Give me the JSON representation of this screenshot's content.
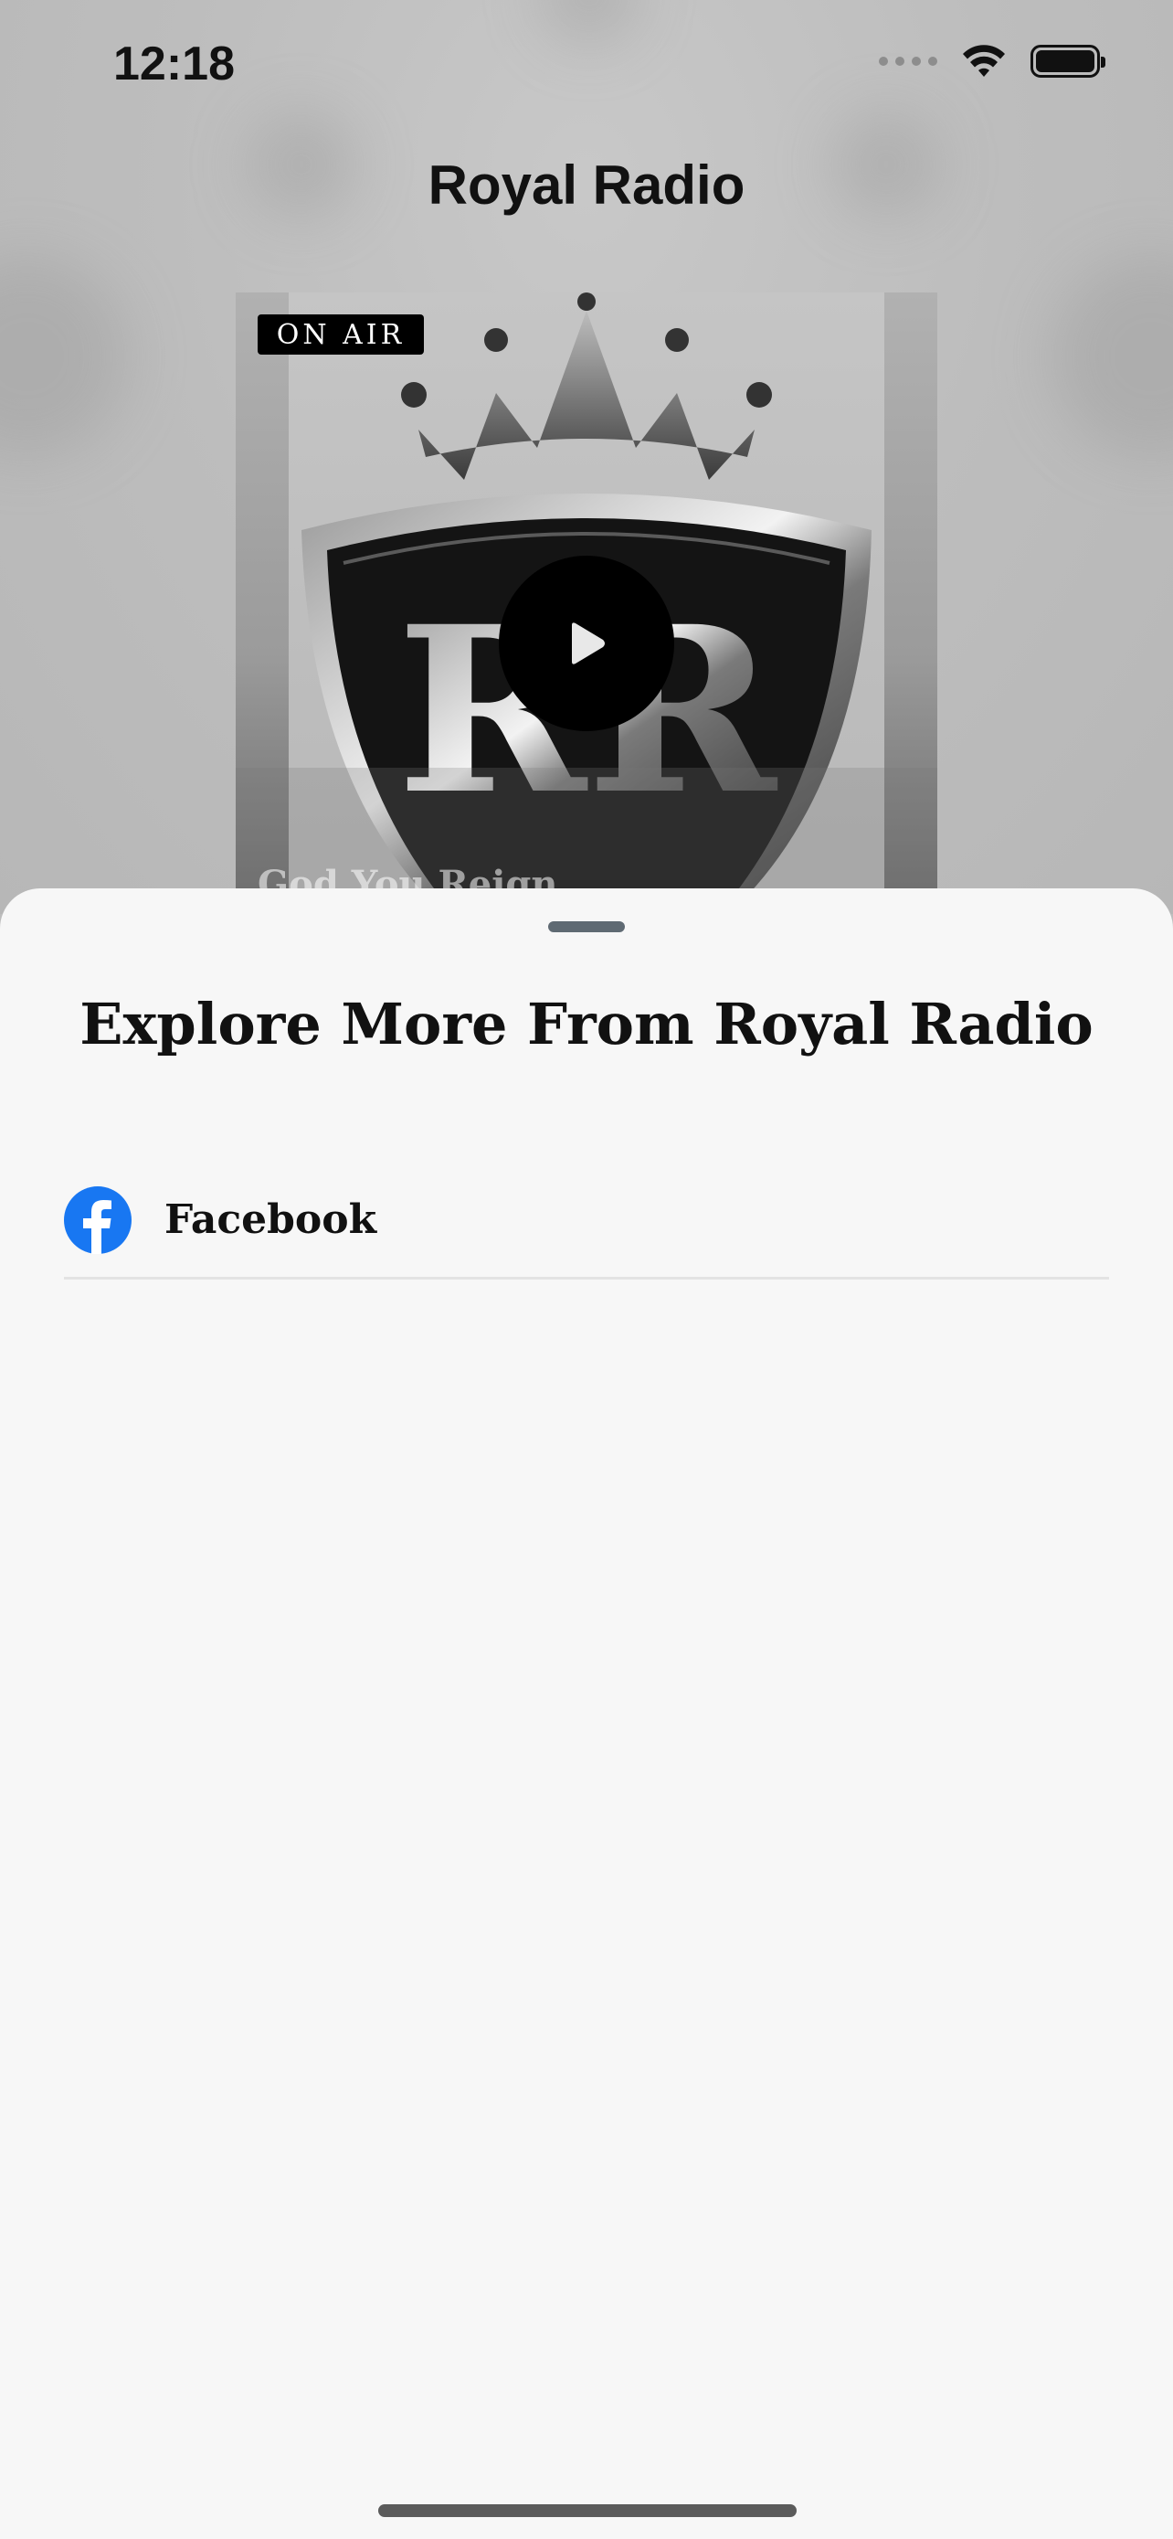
{
  "status_bar": {
    "time": "12:18",
    "icons": [
      "signal-icon",
      "wifi-icon",
      "battery-icon"
    ]
  },
  "app": {
    "title": "Royal Radio",
    "badge": "ON AIR",
    "now_playing_title": "God You Reign",
    "logo_text": "RR"
  },
  "sheet": {
    "title": "Explore More From Royal Radio",
    "items": [
      {
        "label": "Facebook",
        "icon": "facebook-icon",
        "color": "#1877F2"
      }
    ]
  }
}
